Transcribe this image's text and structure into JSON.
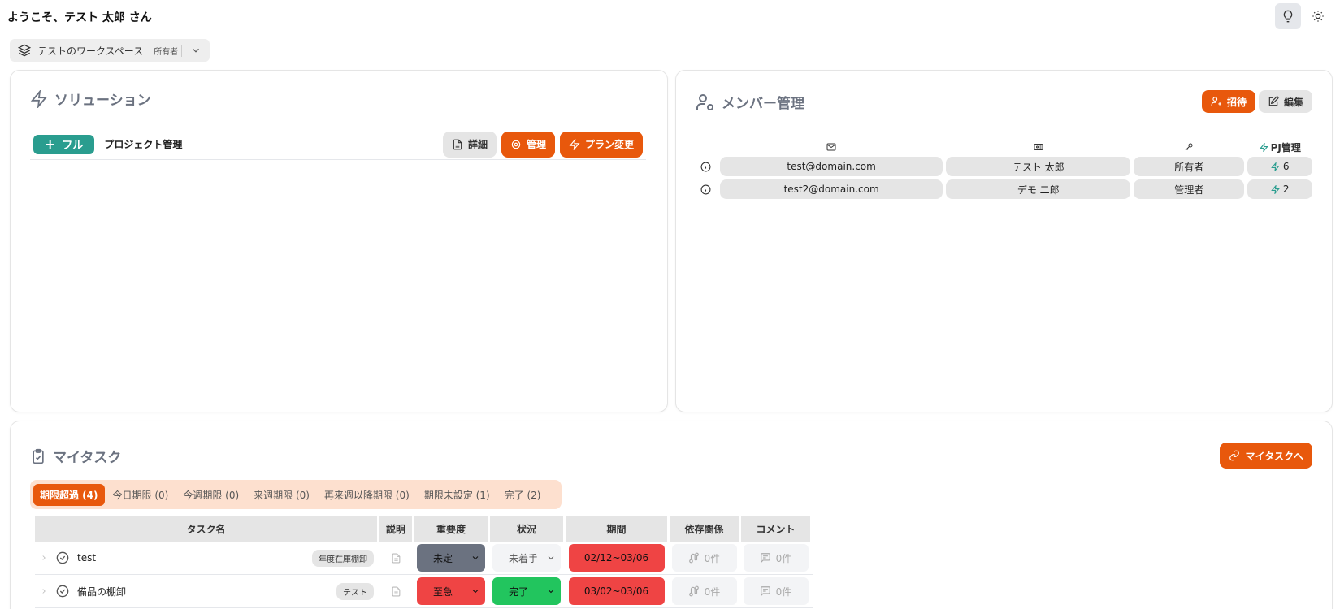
{
  "header": {
    "welcome": "ようこそ、テスト 太郎 さん"
  },
  "workspace": {
    "name": "テストのワークスペース",
    "role": "所有者"
  },
  "solution": {
    "title": "ソリューション",
    "items": [
      {
        "plan": "フル",
        "name": "プロジェクト管理",
        "detail_label": "詳細",
        "manage_label": "管理",
        "change_label": "プラン変更"
      }
    ]
  },
  "members": {
    "title": "メンバー管理",
    "invite_label": "招待",
    "edit_label": "編集",
    "pj_header": "PJ管理",
    "rows": [
      {
        "email": "test@domain.com",
        "name": "テスト 太郎",
        "role": "所有者",
        "pj": "6"
      },
      {
        "email": "test2@domain.com",
        "name": "デモ 二郎",
        "role": "管理者",
        "pj": "2"
      }
    ]
  },
  "tasks": {
    "title": "マイタスク",
    "link_label": "マイタスクへ",
    "tabs": [
      "期限超過 (4)",
      "今日期限 (0)",
      "今週期限 (0)",
      "来週期限 (0)",
      "再来週以降期限 (0)",
      "期限未設定 (1)",
      "完了 (2)"
    ],
    "headers": {
      "name": "タスク名",
      "desc": "説明",
      "importance": "重要度",
      "status": "状況",
      "period": "期間",
      "deps": "依存関係",
      "comments": "コメント"
    },
    "rows": [
      {
        "name": "test",
        "tag": "年度在庫棚卸",
        "importance": "未定",
        "status": "未着手",
        "period": "02/12~03/06",
        "deps": "0件",
        "comments": "0件"
      },
      {
        "name": "備品の棚卸",
        "tag": "テスト",
        "importance": "至急",
        "status": "完了",
        "period": "03/02~03/06",
        "deps": "0件",
        "comments": "0件"
      }
    ]
  },
  "colors": {
    "accent": "#e8580c",
    "teal": "#2a9d8f",
    "danger": "#ef4444",
    "success": "#22c55e",
    "muted": "#6b7280"
  }
}
